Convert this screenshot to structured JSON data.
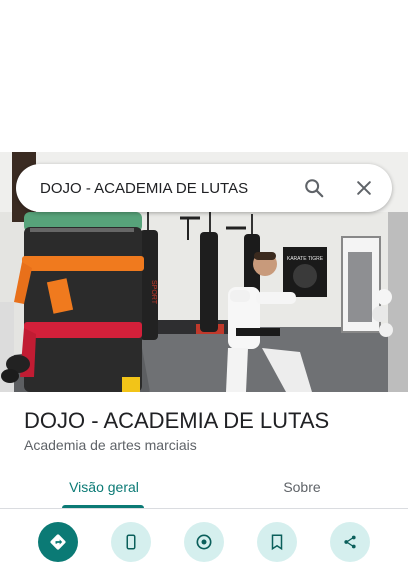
{
  "search": {
    "query": "DOJO - ACADEMIA DE LUTAS"
  },
  "photo": {
    "poster_text": "KARATE TIGRE",
    "bag_brand": "SPORT"
  },
  "place": {
    "name": "DOJO - ACADEMIA DE LUTAS",
    "category": "Academia de artes marciais"
  },
  "tabs": [
    {
      "label": "Visão geral",
      "active": true
    },
    {
      "label": "Sobre",
      "active": false
    }
  ],
  "actions": [
    {
      "icon": "directions-icon"
    },
    {
      "icon": "phone-icon"
    },
    {
      "icon": "start-navigation-icon"
    },
    {
      "icon": "save-icon"
    },
    {
      "icon": "share-icon"
    }
  ],
  "colors": {
    "accent": "#0b7a75",
    "action_bg": "#d5efee"
  }
}
